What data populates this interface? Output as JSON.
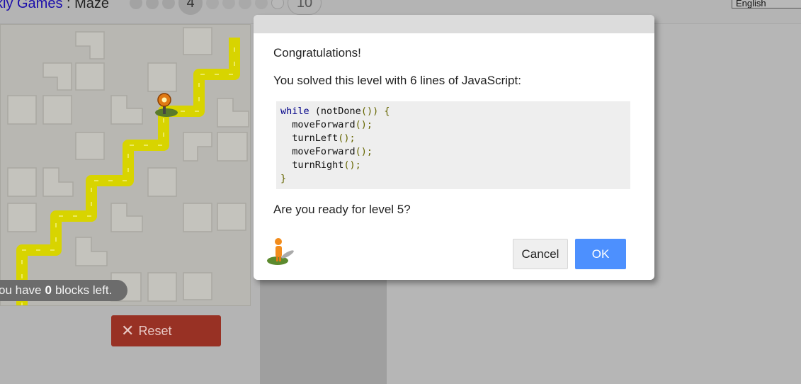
{
  "header": {
    "link_text": "kly Games",
    "separator": " : ",
    "game_title": "Maze",
    "current_level": "4",
    "last_level": "10",
    "language": "English"
  },
  "maze": {
    "blocks_prefix": "ou have",
    "blocks_count": "0",
    "blocks_suffix": "blocks left."
  },
  "controls": {
    "reset_label": "Reset"
  },
  "dialog": {
    "congrats": "Congratulations!",
    "solved_text": "You solved this level with 6 lines of JavaScript:",
    "code": [
      [
        {
          "c": "kw",
          "t": "while"
        },
        {
          "c": "id",
          "t": " ("
        },
        {
          "c": "id",
          "t": "notDone"
        },
        {
          "c": "pn",
          "t": "()) {"
        }
      ],
      [
        {
          "c": "id",
          "t": "  moveForward"
        },
        {
          "c": "pn",
          "t": "();"
        }
      ],
      [
        {
          "c": "id",
          "t": "  turnLeft"
        },
        {
          "c": "pn",
          "t": "();"
        }
      ],
      [
        {
          "c": "id",
          "t": "  moveForward"
        },
        {
          "c": "pn",
          "t": "();"
        }
      ],
      [
        {
          "c": "id",
          "t": "  turnRight"
        },
        {
          "c": "pn",
          "t": "();"
        }
      ],
      [
        {
          "c": "pn",
          "t": "}"
        }
      ]
    ],
    "ready_text": "Are you ready for level 5?",
    "cancel_label": "Cancel",
    "ok_label": "OK"
  },
  "colors": {
    "path": "#d8d400",
    "ok_button": "#4d90fe",
    "reset_button": "#983124"
  }
}
